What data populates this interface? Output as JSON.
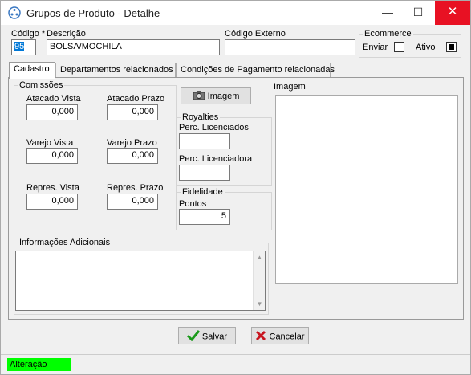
{
  "window": {
    "title": "Grupos de Produto - Detalhe",
    "minimize": "—",
    "maximize": "☐",
    "close": "✕"
  },
  "header": {
    "codigo_label": "Código *",
    "codigo_value": "95",
    "descricao_label": "Descrição",
    "descricao_value": "BOLSA/MOCHILA",
    "codigo_externo_label": "Código Externo",
    "codigo_externo_value": "",
    "ecommerce_label": "Ecommerce",
    "enviar_label": "Enviar",
    "enviar_checked": false,
    "ativo_label": "Ativo",
    "ativo_checked": true
  },
  "tabs": [
    {
      "label": "Cadastro",
      "active": true
    },
    {
      "label": "Departamentos relacionados",
      "active": false
    },
    {
      "label": "Condições de Pagamento relacionadas",
      "active": false
    }
  ],
  "comissoes": {
    "title": "Comissões",
    "atacado_vista_label": "Atacado Vista",
    "atacado_vista_value": "0,000",
    "atacado_prazo_label": "Atacado Prazo",
    "atacado_prazo_value": "0,000",
    "varejo_vista_label": "Varejo Vista",
    "varejo_vista_value": "0,000",
    "varejo_prazo_label": "Varejo Prazo",
    "varejo_prazo_value": "0,000",
    "repres_vista_label": "Repres. Vista",
    "repres_vista_value": "0,000",
    "repres_prazo_label": "Repres. Prazo",
    "repres_prazo_value": "0,000"
  },
  "imagem_button": {
    "label_underlined": "I",
    "label_rest": "magem"
  },
  "royalties": {
    "title": "Royalties",
    "perc_licenciados_label": "Perc. Licenciados",
    "perc_licenciados_value": "",
    "perc_licenciadora_label": "Perc. Licenciadora",
    "perc_licenciadora_value": ""
  },
  "fidelidade": {
    "title": "Fidelidade",
    "pontos_label": "Pontos",
    "pontos_value": "5"
  },
  "imagem_panel": {
    "label": "Imagem"
  },
  "informacoes": {
    "title": "Informações Adicionais",
    "value": ""
  },
  "actions": {
    "salvar_underlined": "S",
    "salvar_rest": "alvar",
    "cancelar_underlined": "C",
    "cancelar_rest": "ancelar"
  },
  "status": {
    "text": "Alteração",
    "color": "#00ff00"
  }
}
